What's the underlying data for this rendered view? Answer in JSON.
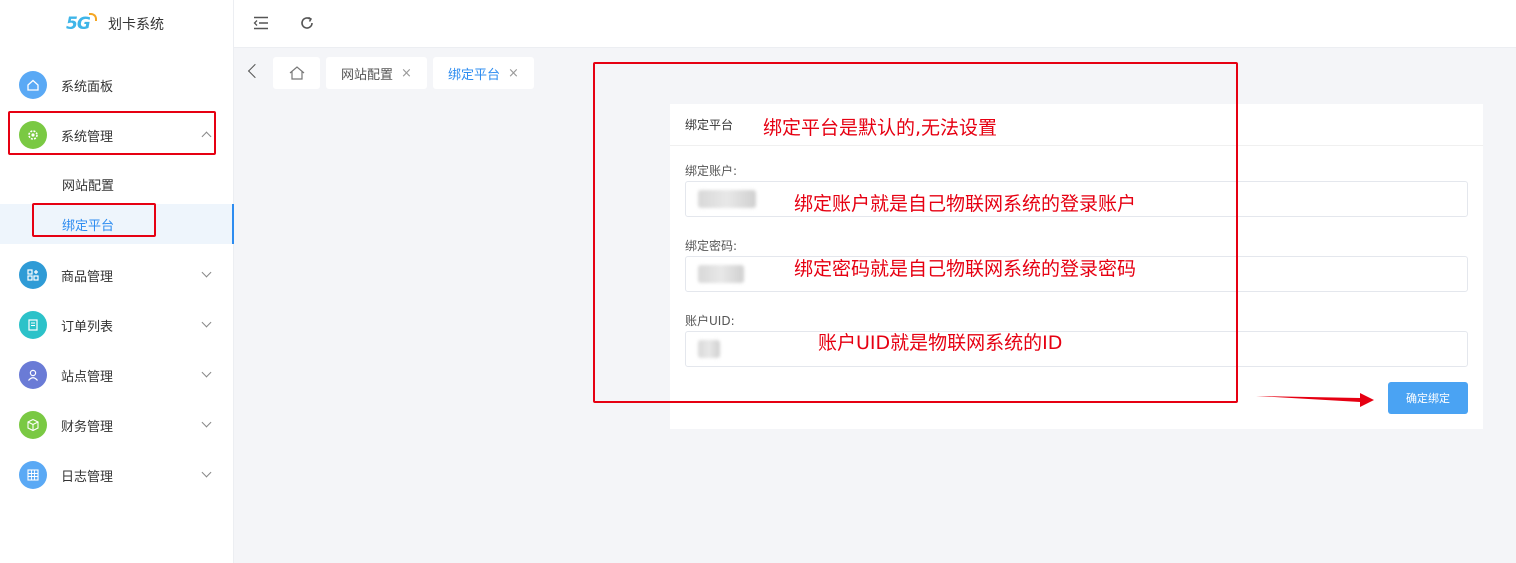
{
  "app": {
    "logo_mark": "5G",
    "title": "划卡系统"
  },
  "sidebar": {
    "items": [
      {
        "label": "系统面板",
        "icon": "home-icon",
        "color": "#5aa9f5"
      },
      {
        "label": "系统管理",
        "icon": "gear-icon",
        "color": "#7ac943"
      },
      {
        "label": "商品管理",
        "icon": "grid-icon",
        "color": "#2f9bd6"
      },
      {
        "label": "订单列表",
        "icon": "list-icon",
        "color": "#2cc2c9"
      },
      {
        "label": "站点管理",
        "icon": "user-icon",
        "color": "#6a7bd6"
      },
      {
        "label": "财务管理",
        "icon": "cube-icon",
        "color": "#7ac943"
      },
      {
        "label": "日志管理",
        "icon": "table-icon",
        "color": "#5aa9f5"
      }
    ],
    "sub_items": [
      {
        "label": "网站配置"
      },
      {
        "label": "绑定平台"
      }
    ]
  },
  "tabs": [
    {
      "label": "网站配置",
      "close": "×"
    },
    {
      "label": "绑定平台",
      "close": "×"
    }
  ],
  "form": {
    "title": "绑定平台",
    "account_label": "绑定账户:",
    "password_label": "绑定密码:",
    "uid_label": "账户UID:",
    "submit_label": "确定绑定"
  },
  "annotations": {
    "platform": "绑定平台是默认的,无法设置",
    "account": "绑定账户就是自己物联网系统的登录账户",
    "password": "绑定密码就是自己物联网系统的登录密码",
    "uid": "账户UID就是物联网系统的ID"
  },
  "colors": {
    "accent": "#2d8cf0",
    "annotation": "#e60012",
    "button": "#4aa3f3"
  }
}
